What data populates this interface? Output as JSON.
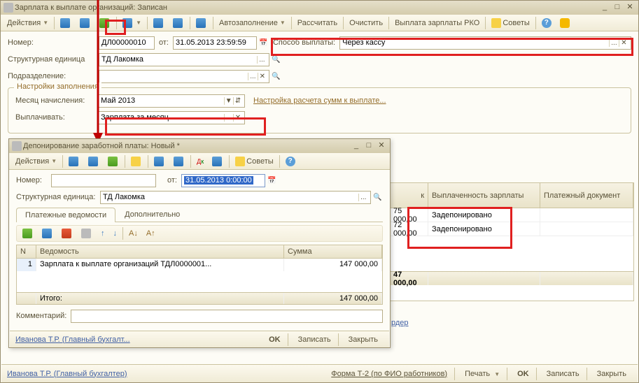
{
  "main": {
    "title": "Зарплата к выплате организаций: Записан",
    "toolbar": {
      "actions": "Действия",
      "autofill": "Автозаполнение",
      "calc": "Рассчитать",
      "clear": "Очистить",
      "payout_rko": "Выплата зарплаты РКО",
      "tips": "Советы",
      "help": "?"
    },
    "fields": {
      "number_label": "Номер:",
      "number_value": "ДЛ00000010",
      "from_label": "от:",
      "date_value": "31.05.2013 23:59:59",
      "method_label": "Способ выплаты:",
      "method_value": "Через кассу",
      "unit_label": "Структурная единица",
      "unit_value": "ТД Лакомка",
      "dept_label": "Подразделение:",
      "dept_value": ""
    },
    "group": {
      "title": "Настройки заполнения",
      "month_label": "Месяц начисления:",
      "month_value": "Май 2013",
      "calc_link": "Настройка расчета сумм к выплате...",
      "pay_label": "Выплачивать:",
      "pay_value": "Зарплата за месяц"
    },
    "table": {
      "col_amount_end": "к",
      "col_paid": "Выплаченность зарплаты",
      "col_doc": "Платежный документ",
      "rows": [
        {
          "amount": "75 000,00",
          "paid": "Задепонировано"
        },
        {
          "amount": "72 000,00",
          "paid": "Задепонировано"
        }
      ],
      "total": "47 000,00",
      "order_link": "рдер"
    },
    "statusbar": {
      "user": "Иванова Т.Р. (Главный бухгалтер)",
      "form": "Форма Т-2 (по ФИО работников)",
      "print": "Печать",
      "ok": "OK",
      "write": "Записать",
      "close": "Закрыть"
    }
  },
  "sub": {
    "title": "Депонирование заработной платы: Новый *",
    "toolbar": {
      "actions": "Действия",
      "tips": "Советы"
    },
    "fields": {
      "number_label": "Номер:",
      "number_value": "",
      "from_label": "от:",
      "date_value": "31.05.2013 0:00:00",
      "unit_label": "Структурная единица:",
      "unit_value": "ТД Лакомка"
    },
    "tabs": {
      "t1": "Платежные ведомости",
      "t2": "Дополнительно"
    },
    "table": {
      "col_n": "N",
      "col_doc": "Ведомость",
      "col_sum": "Сумма",
      "row_n": "1",
      "row_doc": "Зарплата к выплате организаций ТДЛ0000001...",
      "row_sum": "147 000,00",
      "total_label": "Итого:",
      "total_sum": "147 000,00"
    },
    "comment_label": "Комментарий:",
    "statusbar": {
      "user": "Иванова Т.Р. (Главный бухгалт...",
      "ok": "OK",
      "write": "Записать",
      "close": "Закрыть"
    }
  }
}
